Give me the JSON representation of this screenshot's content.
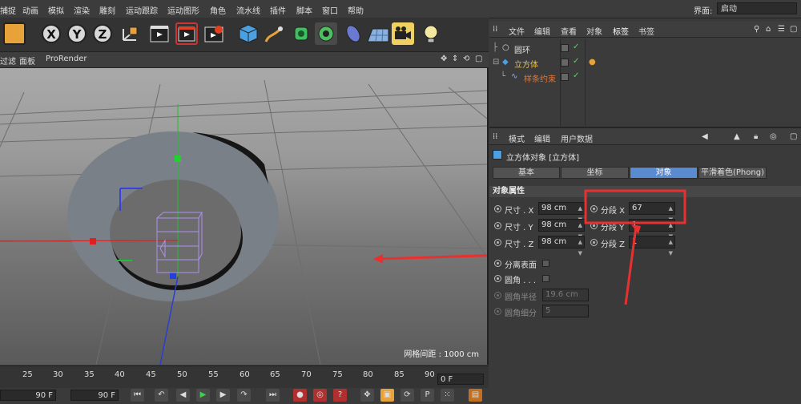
{
  "menubar": {
    "items": [
      "捕捉",
      "动画",
      "模拟",
      "渲染",
      "雕刻",
      "运动跟踪",
      "运动图形",
      "角色",
      "流水线",
      "插件",
      "脚本",
      "窗口",
      "帮助"
    ],
    "layout_label": "界面:",
    "layout_value": "启动"
  },
  "toolbar": {
    "axis_x": "X",
    "axis_y": "Y",
    "axis_z": "Z"
  },
  "viewport_menu": {
    "items": [
      "过滤",
      "面板",
      "ProRender"
    ],
    "grid_spacing": "网格间距 : 1000 cm"
  },
  "timeline": {
    "ticks": [
      "25",
      "30",
      "35",
      "40",
      "45",
      "50",
      "55",
      "60",
      "65",
      "70",
      "75",
      "80",
      "85",
      "90"
    ],
    "current_frame": "0 F",
    "start_field": "90 F",
    "end_field": "90 F"
  },
  "object_manager": {
    "menu": [
      "文件",
      "编辑",
      "查看",
      "对象",
      "标签",
      "书签"
    ],
    "objects": [
      {
        "name": "圆环",
        "color": "#d8d8d8"
      },
      {
        "name": "立方体",
        "color": "#f0c040"
      },
      {
        "name": "样条约束",
        "color": "#e07838"
      }
    ]
  },
  "attribute_manager": {
    "menu": [
      "模式",
      "编辑",
      "用户数据"
    ],
    "title": "立方体对象 [立方体]",
    "tabs": [
      "基本",
      "坐标",
      "对象",
      "平滑着色(Phong)"
    ],
    "active_tab": "对象",
    "section": "对象属性",
    "size_x_label": "尺寸 . X",
    "size_x": "98 cm",
    "size_y_label": "尺寸 . Y",
    "size_y": "98 cm",
    "size_z_label": "尺寸 . Z",
    "size_z": "98 cm",
    "seg_x_label": "分段 X",
    "seg_x": "67",
    "seg_y_label": "分段 Y",
    "seg_y": "1",
    "seg_z_label": "分段 Z",
    "seg_z": "1",
    "separate_label": "分离表面",
    "fillet_label": "圆角 . . .",
    "fillet_radius_label": "圆角半径",
    "fillet_radius": "19.6 cm",
    "fillet_sub_label": "圆角细分",
    "fillet_sub": "5"
  },
  "colors": {
    "accent": "#5a8ad0",
    "annotation": "#e83030"
  }
}
